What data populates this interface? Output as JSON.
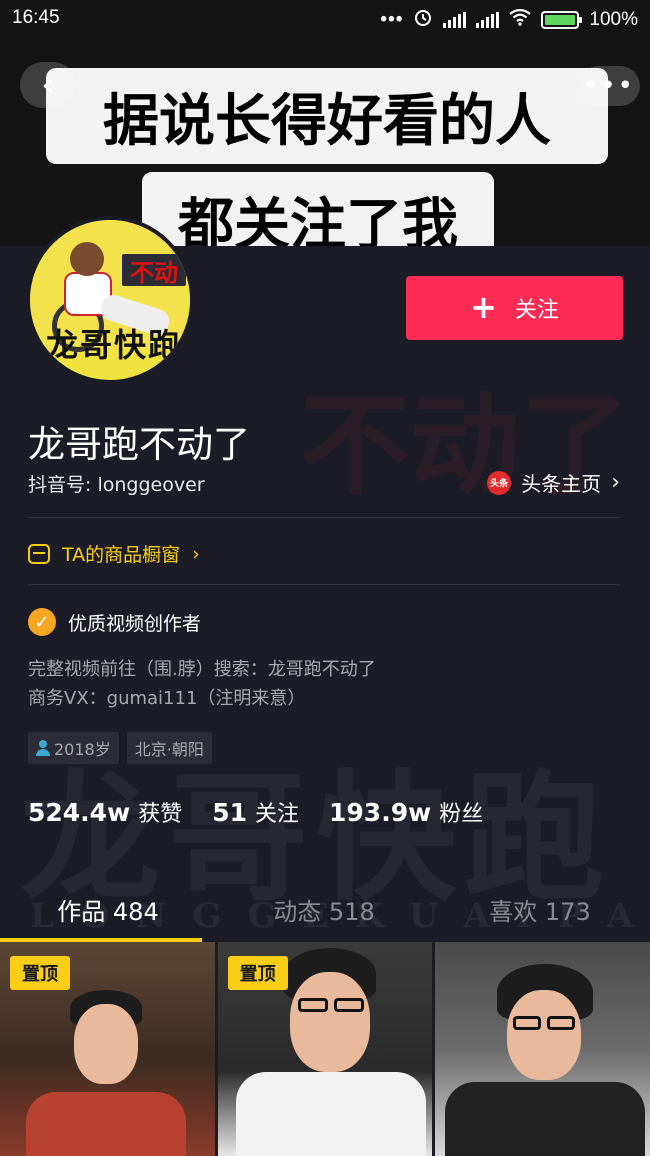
{
  "status_bar": {
    "time": "16:45",
    "dots": "•••",
    "battery_text": "100%",
    "battery_level": 1.0
  },
  "cover": {
    "line1": "据说长得好看的人",
    "line2": "都关注了我"
  },
  "avatar": {
    "badge_text": "不动",
    "brand_text": "龙哥快跑"
  },
  "follow_button": {
    "label": "关注"
  },
  "profile": {
    "nickname": "龙哥跑不动了",
    "douyin_id": "抖音号: longgeover",
    "toutiao_label": "头条主页",
    "toutiao_logo": "头条",
    "shop_label": "TA的商品橱窗",
    "verified_label": "优质视频创作者",
    "bio_line1": "完整视频前往（围.脖）搜索：龙哥跑不动了",
    "bio_line2": "商务VX：gumai111（注明来意）",
    "tags": {
      "age": "2018岁",
      "location": "北京·朝阳"
    }
  },
  "stats": {
    "likes_num": "524.4w",
    "likes_label": "获赞",
    "following_num": "51",
    "following_label": "关注",
    "followers_num": "193.9w",
    "followers_label": "粉丝"
  },
  "tabs": {
    "works": "作品 484",
    "posts": "动态 518",
    "likes": "喜欢 173"
  },
  "videos": {
    "pin_label": "置顶"
  },
  "colors": {
    "accent_red": "#fe2c55",
    "accent_yellow": "#face15",
    "background": "#1b1c26"
  },
  "icons": {
    "back": "chevron-left-icon",
    "more": "more-dots-icon",
    "shop": "shop-window-icon",
    "verified": "check-badge-icon",
    "age": "person-icon",
    "toutiao": "toutiao-logo-icon"
  }
}
